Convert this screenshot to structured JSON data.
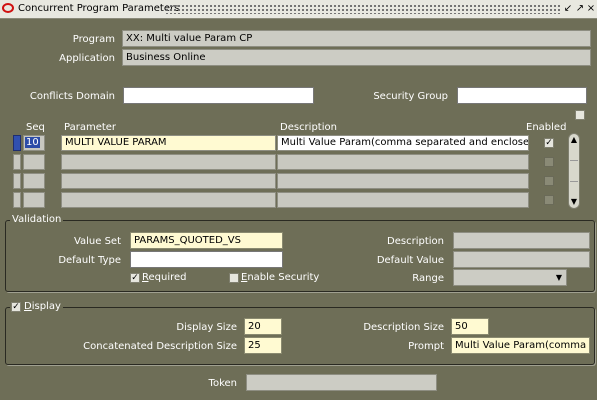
{
  "window": {
    "title": "Concurrent Program Parameters",
    "controls": [
      "↙",
      "↗",
      "×"
    ]
  },
  "header": {
    "program_label": "Program",
    "program_value": "XX: Multi value Param CP",
    "application_label": "Application",
    "application_value": "Business Online",
    "conflicts_label": "Conflicts Domain",
    "conflicts_value": "",
    "security_label": "Security Group",
    "security_value": ""
  },
  "table": {
    "headers": {
      "seq": "Seq",
      "parameter": "Parameter",
      "description": "Description",
      "enabled": "Enabled"
    },
    "rows": [
      {
        "seq": "10",
        "parameter": "MULTI VALUE PARAM",
        "description": "Multi Value Param(comma separated and enclosed wi",
        "enabled": true
      },
      {
        "seq": "",
        "parameter": "",
        "description": "",
        "enabled": false
      },
      {
        "seq": "",
        "parameter": "",
        "description": "",
        "enabled": false
      },
      {
        "seq": "",
        "parameter": "",
        "description": "",
        "enabled": false
      }
    ]
  },
  "validation": {
    "group_label": "Validation",
    "value_set_label": "Value Set",
    "value_set_value": "PARAMS_QUOTED_VS",
    "default_type_label": "Default Type",
    "default_type_value": "",
    "required_label": "Required",
    "required_checked": true,
    "enable_security_label": "Enable Security",
    "enable_security_checked": false,
    "description_label": "Description",
    "description_value": "",
    "default_value_label": "Default Value",
    "default_value_value": "",
    "range_label": "Range",
    "range_value": ""
  },
  "display": {
    "group_label": "Display",
    "display_checked": true,
    "display_size_label": "Display Size",
    "display_size_value": "20",
    "concat_size_label": "Concatenated Description Size",
    "concat_size_value": "25",
    "description_size_label": "Description Size",
    "description_size_value": "50",
    "prompt_label": "Prompt",
    "prompt_value": "Multi Value Param(comma se"
  },
  "token": {
    "label": "Token",
    "value": ""
  },
  "colors": {
    "background": "#6e6e57",
    "required_field": "#fffad2",
    "current_row": "#3050b0",
    "oracle_logo": "#d01010"
  }
}
